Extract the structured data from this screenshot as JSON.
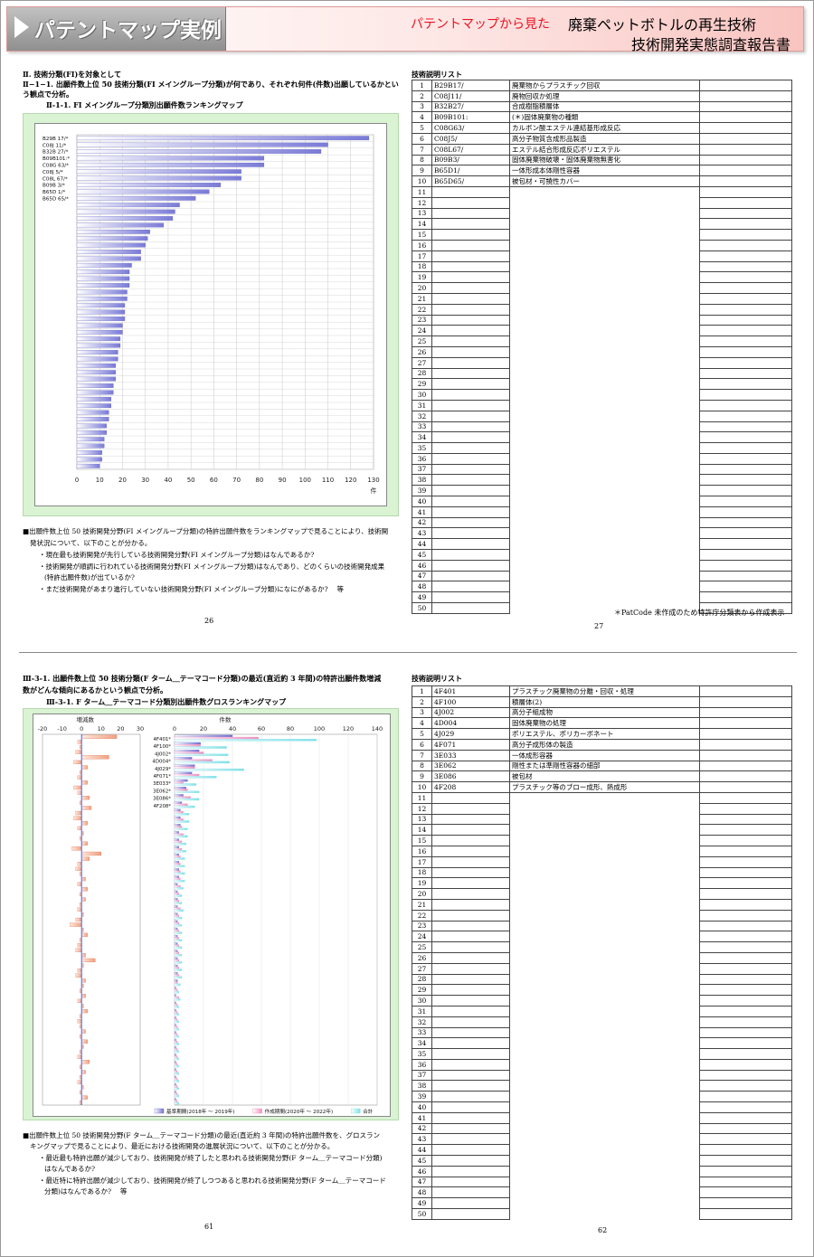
{
  "header": {
    "banner": "パテントマップ実例",
    "subtitle": "パテントマップから見た",
    "title_line1": "廃棄ペットボトルの再生技術",
    "title_line2": "技術開発実態調査報告書"
  },
  "page26": {
    "section": "Ⅱ. 技術分類(FI)を対象として",
    "heading1": "Ⅱ−1−1. 出願件数上位 50 技術分類(FI メイングループ分類)が何であり、それぞれ何件(件数)出願しているかとい",
    "heading2": "う観点で分析。",
    "chart_title": "Ⅱ-1-1. FI メイングループ分類別出願件数ランキングマップ",
    "bullet1": "■出願件数上位 50 技術開発分野(FI メイングループ分類)の特許出願件数をランキングマップで見ることにより、技術開",
    "bullet1b": "発状況について、以下のことが分かる。",
    "line1": "・現在最も技術開発が先行している技術開発分野(FI メイングループ分類)はなんであるか?",
    "line2": "・技術開発が順調に行われている技術開発分野(FI メイングループ分類)はなんであり、どのくらいの技術開発成果",
    "line2b": "(特許出願件数)が出ているか?",
    "line3": "・まだ技術開発があまり進行していない技術開発分野(FI メイングループ分類)になにがあるか?　 等",
    "page_no": "26"
  },
  "page27": {
    "list_title": "技術説明リスト",
    "footnote": "＊PatCode 未作成のため特許庁分類表から作成表示",
    "page_no": "27",
    "rows": [
      {
        "no": "1",
        "code": "B29B17/",
        "desc": "廃棄物からプラスチック回収"
      },
      {
        "no": "2",
        "code": "C08J11/",
        "desc": "廃物回収か処理"
      },
      {
        "no": "3",
        "code": "B32B27/",
        "desc": "合成樹脂積層体"
      },
      {
        "no": "4",
        "code": "B09B101:",
        "desc": "(＊)固体廃棄物の種類"
      },
      {
        "no": "5",
        "code": "C08G63/",
        "desc": "カルボン酸エステル連結基形成反応"
      },
      {
        "no": "6",
        "code": "C08J5/",
        "desc": "高分子物質含成形品製造"
      },
      {
        "no": "7",
        "code": "C08L67/",
        "desc": "エステル結合形成反応ポリエステル"
      },
      {
        "no": "8",
        "code": "B09B3/",
        "desc": "固体廃棄物破壊・固体廃棄物無害化"
      },
      {
        "no": "9",
        "code": "B65D1/",
        "desc": "一体形成本体剛性容器"
      },
      {
        "no": "10",
        "code": "B65D65/",
        "desc": "被包材・可撓性カバー"
      }
    ],
    "empty_numbers": [
      "11",
      "12",
      "13",
      "14",
      "15",
      "16",
      "17",
      "18",
      "19",
      "20",
      "21",
      "22",
      "23",
      "24",
      "25",
      "26",
      "27",
      "28",
      "29",
      "30",
      "31",
      "32",
      "33",
      "34",
      "35",
      "36",
      "37",
      "38",
      "39",
      "40",
      "41",
      "42",
      "43",
      "44",
      "45",
      "46",
      "47",
      "48",
      "49",
      "50"
    ]
  },
  "page61": {
    "heading1": "Ⅲ-3-1. 出願件数上位 50 技術分類(F ターム＿テーマコード分類)の最近(直近約 3 年間)の特許出願件数増減",
    "heading2": "数がどんな傾向にあるかという観点で分析。",
    "chart_title": "Ⅲ-3-1. F ターム＿テーマコード分類別出願件数グロスランキングマップ",
    "bullet1": "■出願件数上位 50 技術開発分野(F ターム＿テーマコード分類)の最近(直近約 3 年間)の特許出願件数を、グロスラン",
    "bullet1b": "キングマップで見ることにより、最近における技術開発の進展状況について、以下のことが分かる。",
    "line1": "・最近最も特許出願が減少しており、技術開発が終了したと思われる技術開発分野(F ターム＿テーマコード分類)",
    "line1b": "はなんであるか?",
    "line2": "・最近特に特許出願が減少しており、技術開発が終了しつつあると思われる技術開発分野(F ターム＿テーマコード",
    "line2b": "分類)はなんであるか?　 等",
    "page_no": "61"
  },
  "page62": {
    "list_title": "技術説明リスト",
    "page_no": "62",
    "rows": [
      {
        "no": "1",
        "code": "4F401",
        "desc": "プラスチック廃棄物の分離・回収・処理"
      },
      {
        "no": "2",
        "code": "4F100",
        "desc": "積層体(2)"
      },
      {
        "no": "3",
        "code": "4J002",
        "desc": "高分子組成物"
      },
      {
        "no": "4",
        "code": "4D004",
        "desc": "固体廃棄物の処理"
      },
      {
        "no": "5",
        "code": "4J029",
        "desc": "ポリエステル、ポリカーボネート"
      },
      {
        "no": "6",
        "code": "4F071",
        "desc": "高分子成形体の製造"
      },
      {
        "no": "7",
        "code": "3E033",
        "desc": "一体成形容器"
      },
      {
        "no": "8",
        "code": "3E062",
        "desc": "剛性または準剛性容器の細部"
      },
      {
        "no": "9",
        "code": "3E086",
        "desc": "被包材"
      },
      {
        "no": "10",
        "code": "4F208",
        "desc": "プラスチック等のブロー成形、熱成形"
      }
    ],
    "empty_numbers": [
      "11",
      "12",
      "13",
      "14",
      "15",
      "16",
      "17",
      "18",
      "19",
      "20",
      "21",
      "22",
      "23",
      "24",
      "25",
      "26",
      "27",
      "28",
      "29",
      "30",
      "31",
      "32",
      "33",
      "34",
      "35",
      "36",
      "37",
      "38",
      "39",
      "40",
      "41",
      "42",
      "43",
      "44",
      "45",
      "46",
      "47",
      "48",
      "49",
      "50"
    ]
  },
  "chart_data": [
    {
      "type": "bar",
      "orientation": "horizontal",
      "categories": [
        "B29B 17/*",
        "C08J 11/*",
        "B32B 27/*",
        "B09B101:*",
        "C08G 63/*",
        "C08J 5/*",
        "C08L 67/*",
        "B09B 3/*",
        "B65D 1/*",
        "B65D 65/*"
      ],
      "values": [
        128,
        110,
        107,
        82,
        82,
        72,
        72,
        63,
        58,
        52,
        45,
        43,
        42,
        38,
        32,
        31,
        30,
        28,
        28,
        24,
        23,
        23,
        23,
        22,
        22,
        21,
        21,
        21,
        20,
        20,
        19,
        19,
        18,
        18,
        17,
        17,
        17,
        16,
        16,
        15,
        15,
        14,
        14,
        13,
        13,
        12,
        12,
        11,
        11,
        10
      ],
      "xlim": [
        0,
        130
      ],
      "xticks": [
        0,
        10,
        20,
        30,
        40,
        50,
        60,
        70,
        80,
        90,
        100,
        110,
        120,
        130
      ],
      "xlabel": "件",
      "grid": true,
      "bar_color": "#7a7ad8"
    },
    {
      "type": "bar",
      "subtype": "diverging",
      "xlabel": "増減数",
      "xlim": [
        -20,
        30
      ],
      "xticks": [
        -20,
        -10,
        0,
        10,
        20,
        30
      ],
      "bar_color": "#f0a080",
      "values": [
        18,
        -2,
        -1,
        -3,
        14,
        -4,
        3,
        -1,
        -2,
        3,
        -4,
        -2,
        4,
        -1,
        5,
        -3,
        -4,
        3,
        -2,
        1,
        -1,
        3,
        -5,
        10,
        4,
        -2,
        -3,
        -1,
        2,
        -2,
        3,
        -1,
        2,
        -1,
        -2,
        1,
        -3,
        -6,
        1,
        3,
        -1,
        -2,
        -3,
        2,
        7,
        1,
        -2,
        -3,
        2,
        1,
        -1,
        2,
        -2,
        1,
        3,
        -1,
        -2,
        -1,
        2,
        -1,
        3,
        1,
        -1,
        -2,
        4,
        -1,
        2,
        -1,
        -2,
        1,
        -1,
        3,
        -1
      ]
    },
    {
      "type": "bar",
      "subtype": "grouped",
      "categories": [
        "4F401*",
        "4F100*",
        "4J002*",
        "4D004*",
        "4J029*",
        "4F071*",
        "3E033*",
        "3E062*",
        "3E086*",
        "4F208*"
      ],
      "xlabel": "件数",
      "xlim": [
        0,
        140
      ],
      "xticks": [
        0,
        20,
        40,
        60,
        80,
        100,
        120,
        140
      ],
      "series": [
        {
          "name": "基準期間(2018年 ～ 2019年)",
          "color": "#7070d0",
          "values": [
            40,
            18,
            17,
            12,
            14,
            12,
            9,
            8,
            6,
            5,
            4,
            4,
            4,
            3,
            3,
            3,
            3,
            3,
            3,
            3,
            2,
            2,
            2,
            2,
            2,
            2,
            2,
            2,
            2,
            2,
            2,
            2,
            2,
            2,
            1,
            1,
            1,
            1,
            1,
            1,
            1,
            1,
            1,
            1,
            1,
            1,
            1,
            1,
            1,
            1
          ]
        },
        {
          "name": "作成期間(2020年 ～ 2022年)",
          "color": "#f090c0",
          "values": [
            58,
            18,
            20,
            26,
            14,
            17,
            6,
            9,
            11,
            9,
            6,
            6,
            5,
            6,
            5,
            5,
            4,
            4,
            4,
            4,
            4,
            3,
            3,
            4,
            3,
            3,
            3,
            3,
            3,
            3,
            3,
            3,
            3,
            2,
            2,
            3,
            2,
            2,
            2,
            2,
            2,
            2,
            2,
            2,
            2,
            2,
            2,
            2,
            2,
            2
          ]
        },
        {
          "name": "合計",
          "color": "#80e0e8",
          "values": [
            98,
            36,
            37,
            38,
            48,
            29,
            15,
            17,
            17,
            14,
            10,
            10,
            9,
            9,
            8,
            8,
            7,
            7,
            7,
            7,
            6,
            5,
            5,
            6,
            5,
            5,
            5,
            5,
            5,
            5,
            5,
            5,
            5,
            4,
            3,
            4,
            3,
            3,
            3,
            3,
            3,
            3,
            3,
            3,
            3,
            3,
            3,
            3,
            3,
            3
          ]
        }
      ]
    }
  ]
}
